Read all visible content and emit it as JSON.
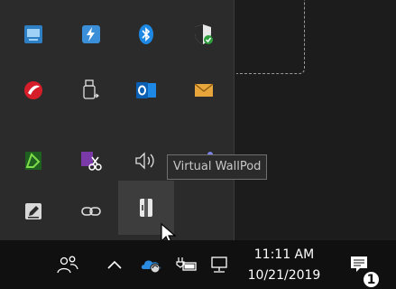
{
  "tooltip": {
    "text": "Virtual WallPod"
  },
  "tray_overflow": {
    "icons": [
      "screen-icon",
      "thunderbolt-icon",
      "bluetooth-icon",
      "shield-icon",
      "antivirus-icon",
      "usb-eject-icon",
      "outlook-icon",
      "mail-icon",
      "snip-icon",
      "onenote-clip-icon",
      "volume-icon",
      "teams-icon",
      "pen-icon",
      "link-icon",
      "wallpod-icon"
    ]
  },
  "taskbar": {
    "time": "11:11 AM",
    "date": "10/21/2019",
    "notification_count": "1"
  },
  "colors": {
    "panel_bg": "#2b2b2b",
    "taskbar_bg": "#101010",
    "tooltip_text": "#c8c8c8",
    "accent_blue": "#1e88e5"
  }
}
